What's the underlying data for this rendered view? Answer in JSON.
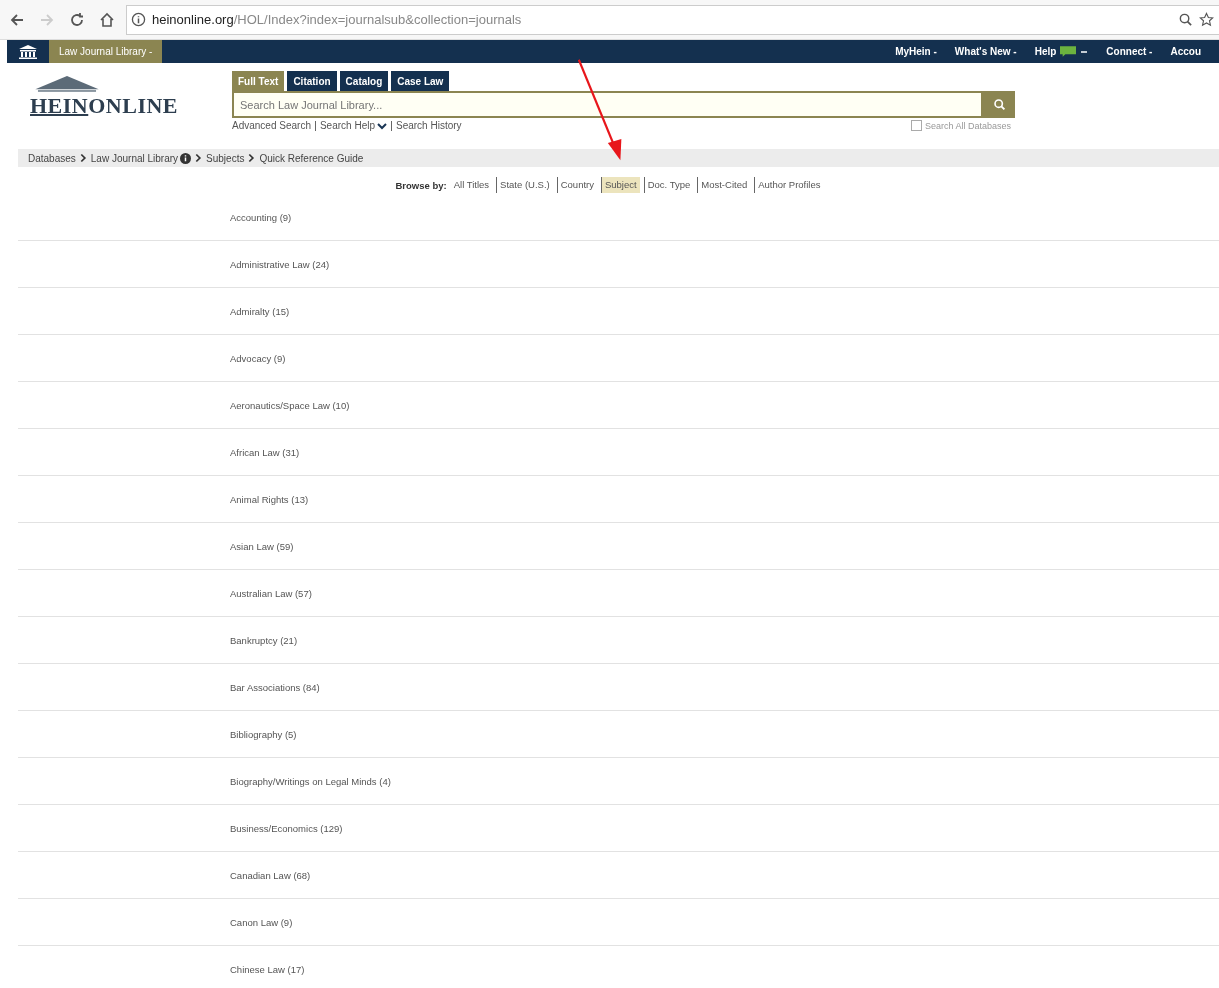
{
  "browser": {
    "url_host": "heinonline.org",
    "url_path": "/HOL/Index?index=journalsub&collection=journals"
  },
  "navbar": {
    "library": "Law Journal Library -",
    "items": [
      {
        "label": "MyHein -",
        "kind": "text"
      },
      {
        "label": "What's New -",
        "kind": "text"
      },
      {
        "label": "Help",
        "kind": "chat"
      },
      {
        "label": "Connect -",
        "kind": "text"
      },
      {
        "label": "Accou",
        "kind": "text"
      }
    ]
  },
  "logo": {
    "text_a": "HEIN",
    "text_b": "ONLINE"
  },
  "search_tabs": [
    {
      "label": "Full Text",
      "selected": true
    },
    {
      "label": "Citation",
      "selected": false
    },
    {
      "label": "Catalog",
      "selected": false
    },
    {
      "label": "Case Law",
      "selected": false
    }
  ],
  "search": {
    "placeholder": "Search Law Journal Library..."
  },
  "search_links": [
    "Advanced Search",
    "Search Help",
    "Search History"
  ],
  "search_all": {
    "label": "Search All Databases",
    "checked": false
  },
  "breadcrumb": [
    {
      "label": "Databases",
      "info": false
    },
    {
      "label": "Law Journal Library",
      "info": true
    },
    {
      "label": "Subjects",
      "info": false
    },
    {
      "label": "Quick Reference Guide",
      "info": false
    }
  ],
  "browse": {
    "label": "Browse by:",
    "options": [
      {
        "label": "All Titles",
        "selected": false
      },
      {
        "label": "State (U.S.)",
        "selected": false
      },
      {
        "label": "Country",
        "selected": false
      },
      {
        "label": "Subject",
        "selected": true
      },
      {
        "label": "Doc. Type",
        "selected": false
      },
      {
        "label": "Most-Cited",
        "selected": false
      },
      {
        "label": "Author Profiles",
        "selected": false
      }
    ]
  },
  "subjects": [
    "Accounting (9)",
    "Administrative Law (24)",
    "Admiralty (15)",
    "Advocacy (9)",
    "Aeronautics/Space Law (10)",
    "African Law (31)",
    "Animal Rights (13)",
    "Asian Law (59)",
    "Australian Law (57)",
    "Bankruptcy (21)",
    "Bar Associations (84)",
    "Bibliography (5)",
    "Biography/Writings on Legal Minds (4)",
    "Business/Economics (129)",
    "Canadian Law (68)",
    "Canon Law (9)",
    "Chinese Law (17)"
  ]
}
